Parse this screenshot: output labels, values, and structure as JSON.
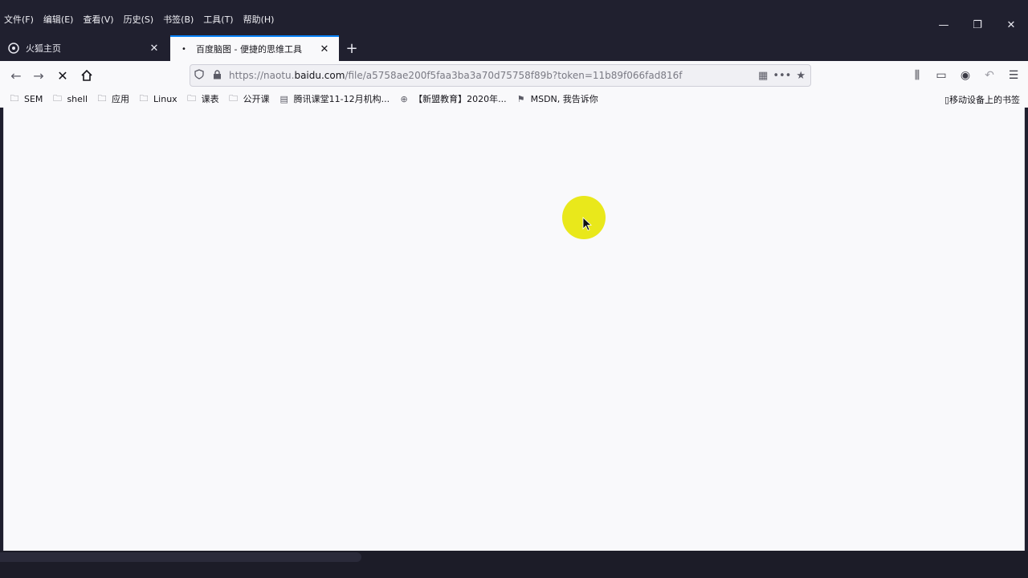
{
  "menu": [
    "文件(F)",
    "编辑(E)",
    "查看(V)",
    "历史(S)",
    "书签(B)",
    "工具(T)",
    "帮助(H)"
  ],
  "window_controls": {
    "minimize": "—",
    "restore": "❐",
    "close": "✕"
  },
  "tabs": [
    {
      "title": "火狐主页",
      "icon": "firefox-icon",
      "active": false
    },
    {
      "title": "百度脑图 - 便捷的思维工具",
      "icon": "loading-dot-icon",
      "active": true
    }
  ],
  "new_tab_label": "+",
  "url": {
    "prefix": "https://naotu.",
    "domain": "baidu.com",
    "path": "/file/a5758ae200f5faa3ba3a70d75758f89b?token=11b89f066fad816f"
  },
  "bookmarks": [
    {
      "label": "SEM",
      "icon": "folder-icon"
    },
    {
      "label": "shell",
      "icon": "folder-icon"
    },
    {
      "label": "应用",
      "icon": "folder-icon"
    },
    {
      "label": "Linux",
      "icon": "folder-icon"
    },
    {
      "label": "课表",
      "icon": "folder-icon"
    },
    {
      "label": "公开课",
      "icon": "folder-icon"
    },
    {
      "label": "腾讯课堂11-12月机构...",
      "icon": "page-icon"
    },
    {
      "label": "【新盟教育】2020年...",
      "icon": "globe-icon"
    },
    {
      "label": "MSDN, 我告诉你",
      "icon": "msdn-icon"
    }
  ],
  "mobile_bookmarks": "移动设备上的书签",
  "colors": {
    "accent": "#0a84ff",
    "cursor_highlight": "#e9e81b"
  }
}
